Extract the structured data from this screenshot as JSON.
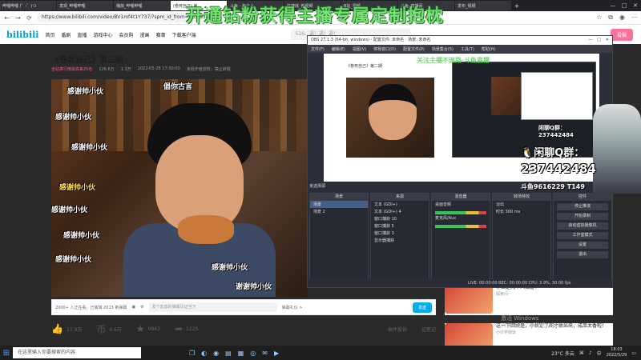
{
  "browser": {
    "tabs": [
      "哔哩哔哩 (゜-゜)つ",
      "发现_哔哩哔哩",
      "播放_哔哩哔哩",
      "(卷死自己) 第...",
      "斗鱼 - 每个人",
      "打游戏_新视频",
      "B站_视频",
      "斗鱼_直播间",
      "发布_视频"
    ],
    "url": "https://www.bilibili.com/video/BV1mf4t1Y737/?spm_id_from=333.934.0.0",
    "nav_back": "←",
    "nav_forward": "→",
    "nav_refresh": "⟳",
    "new_tab": "+",
    "win_min": "—",
    "win_max": "□",
    "win_close": "✕"
  },
  "bili": {
    "logo": "bilibili",
    "nav": [
      "首页",
      "番剧",
      "直播",
      "游戏中心",
      "会员购",
      "漫画",
      "赛事",
      "下载客户端"
    ],
    "search_placeholder": "516、逼！逼！逼！",
    "upload": "投稿"
  },
  "video": {
    "title": "《卷死自己》第二期",
    "hot": "全站排行榜最高第25名",
    "views": "126.6万",
    "danmaku": "1.3万",
    "date": "2022-05-28 17:30:00",
    "copyright": "未经作者授权，禁止转载",
    "danmu": [
      "感谢帅小伙",
      "倡你古言",
      "感谢帅小伙",
      "感谢帅小伙",
      "感谢帅小伙",
      "感谢帅小伙",
      "感谢帅小伙",
      "感谢帅小伙",
      "感谢帅小伙",
      "谢谢帅小伙"
    ]
  },
  "under": {
    "online": "2000+ 人正在看，已装填 2013 条弹幕",
    "input_placeholder": "发个友善的弹幕见证当下",
    "etiquette": "弹幕礼仪 >",
    "send": "发送"
  },
  "actions": [
    {
      "icon": "thumb-up-icon",
      "glyph": "👍",
      "label": "17.9万"
    },
    {
      "icon": "coin-icon",
      "glyph": "币",
      "label": "4.6万"
    },
    {
      "icon": "star-icon",
      "glyph": "★",
      "label": "9843"
    },
    {
      "icon": "share-icon",
      "glyph": "➦",
      "label": "1225"
    }
  ],
  "actions_right": {
    "report": "稿件投诉",
    "note": "记笔记"
  },
  "obs": {
    "title": "OBS 27.1.3 (64-bit, windows) - 配置文件: 未命名 - 场景: 未命名",
    "menu": [
      "文件(F)",
      "编辑(E)",
      "视图(V)",
      "停靠窗口(D)",
      "配置文件(P)",
      "场景集合(S)",
      "工具(T)",
      "帮助(H)"
    ],
    "scene_label": "未选择源",
    "docks": {
      "scenes_title": "场景",
      "scenes": [
        "场景",
        "场景 2"
      ],
      "sources_title": "来源",
      "sources": [
        "文本 (GDI+)",
        "文本 (GDI+) 4",
        "窗口捕获 10",
        "窗口捕获 5",
        "窗口捕获 3",
        "显示器捕获"
      ],
      "mixer_title": "混音器",
      "mixer": [
        "桌面音频",
        "麦克风/Aux"
      ],
      "transition_title": "转场特效",
      "transition": [
        "淡出",
        "时长 300 ms"
      ],
      "controls_title": "控件",
      "controls": [
        "停止推流",
        "开始录制",
        "启动虚拟摄像机",
        "工作室模式",
        "设置",
        "退出"
      ]
    },
    "status": "LIVE: 00:00:00   REC: 00:00:00   CPU: 3.9%, 30.00 fps"
  },
  "overlay": {
    "banner": "开通钻粉获得主播专属定制抱枕",
    "banner2": "关注主播不迷路·斗鱼直播",
    "qq_small_1": "闲聊Q群：",
    "qq_small_2": "237442484",
    "qq_title": "闲聊Q群：",
    "qq_number": "237442484",
    "footer": "斗鱼9616229 T149"
  },
  "recs": [
    {
      "title": "什么是几个人知道？",
      "up": "探索间"
    },
    {
      "title": "这一下回顾是，小伙定了阁才敢出来，成品太香啦！",
      "up": "小伙学做饭"
    }
  ],
  "windows_activate": [
    "激活 Windows",
    "转到\"设置\"以激活 Windows。"
  ],
  "taskbar": {
    "search_placeholder": "在这里输入你要搜索的内容",
    "weather": "23°C 多云",
    "time": "18:03",
    "date": "2022/5/29",
    "lang": "中"
  }
}
